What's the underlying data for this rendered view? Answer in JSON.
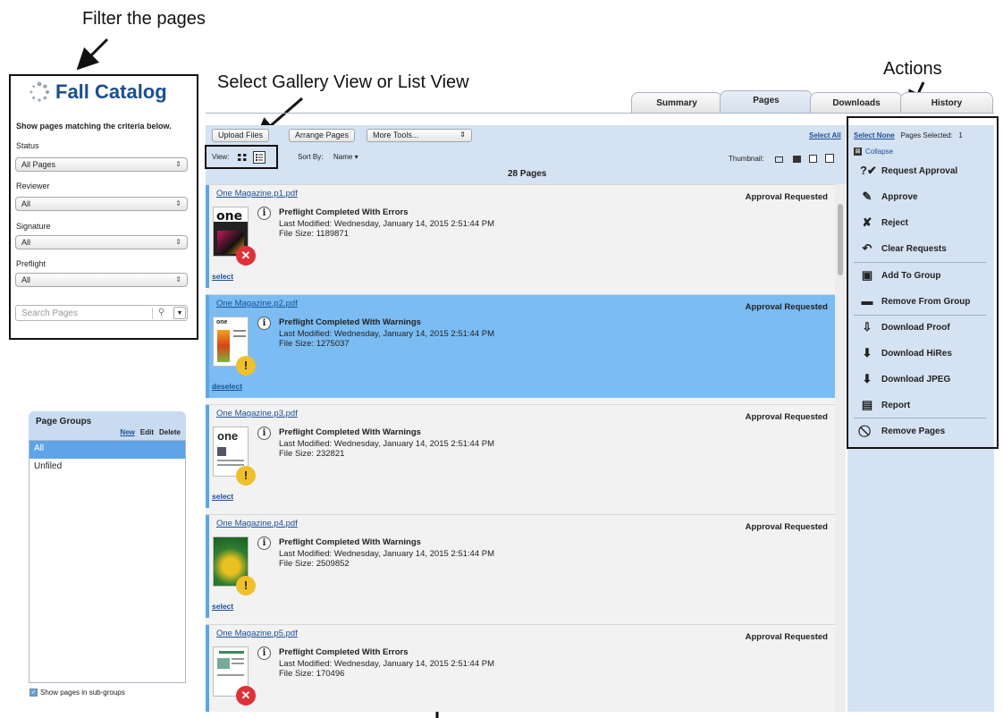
{
  "callouts": {
    "filter": "Filter the pages",
    "view": "Select Gallery View or List View",
    "actions": "Actions"
  },
  "filters": {
    "title": "Fall Catalog",
    "criteria_heading": "Show pages matching the criteria below.",
    "status_label": "Status",
    "status_value": "All Pages",
    "reviewer_label": "Reviewer",
    "reviewer_value": "All",
    "signature_label": "Signature",
    "signature_value": "All",
    "preflight_label": "Preflight",
    "preflight_value": "All",
    "search_placeholder": "Search Pages"
  },
  "page_groups": {
    "title": "Page Groups",
    "new": "New",
    "edit": "Edit",
    "delete": "Delete",
    "items": [
      "All",
      "Unfiled"
    ],
    "subgroups_label": "Show pages in sub-groups"
  },
  "tabs": [
    "Summary",
    "Pages",
    "Downloads",
    "History"
  ],
  "toolbar": {
    "upload": "Upload Files",
    "arrange": "Arrange Pages",
    "more_tools": "More Tools...",
    "select_all": "Select All",
    "select_none": "Select None",
    "pages_selected_label": "Pages Selected:",
    "pages_selected_count": "1",
    "view_label": "View:",
    "sort_label": "Sort By:",
    "sort_value": "Name",
    "thumbnail_label": "Thumbnail:",
    "page_count": "28 Pages",
    "collapse": "Collapse"
  },
  "pages": [
    {
      "file": "One Magazine.p1.pdf",
      "status": "Approval Requested",
      "preflight": "Preflight Completed With Errors",
      "modified": "Last Modified: Wednesday, January 14, 2015 2:51:44 PM",
      "size": "File Size: 1189871",
      "action": "select",
      "badge": "error"
    },
    {
      "file": "One Magazine.p2.pdf",
      "status": "Approval Requested",
      "preflight": "Preflight Completed With Warnings",
      "modified": "Last Modified: Wednesday, January 14, 2015 2:51:44 PM",
      "size": "File Size: 1275037",
      "action": "deselect",
      "badge": "warning"
    },
    {
      "file": "One Magazine.p3.pdf",
      "status": "Approval Requested",
      "preflight": "Preflight Completed With Warnings",
      "modified": "Last Modified: Wednesday, January 14, 2015 2:51:44 PM",
      "size": "File Size: 232821",
      "action": "select",
      "badge": "warning"
    },
    {
      "file": "One Magazine.p4.pdf",
      "status": "Approval Requested",
      "preflight": "Preflight Completed With Warnings",
      "modified": "Last Modified: Wednesday, January 14, 2015 2:51:44 PM",
      "size": "File Size: 2509852",
      "action": "select",
      "badge": "warning"
    },
    {
      "file": "One Magazine.p5.pdf",
      "status": "Approval Requested",
      "preflight": "Preflight Completed With Errors",
      "modified": "Last Modified: Wednesday, January 14, 2015 2:51:44 PM",
      "size": "File Size: 170496",
      "action": "select",
      "badge": "error"
    }
  ],
  "actions": {
    "request_approval": "Request Approval",
    "approve": "Approve",
    "reject": "Reject",
    "clear_requests": "Clear Requests",
    "add_to_group": "Add To Group",
    "remove_from_group": "Remove From Group",
    "download_proof": "Download Proof",
    "download_hires": "Download HiRes",
    "download_jpeg": "Download JPEG",
    "report": "Report",
    "remove_pages": "Remove Pages"
  },
  "colors": {
    "accent": "#1a4f8c",
    "panel": "#d5e2f2",
    "selected_row": "#7bbcf2",
    "error": "#e0303a",
    "warning": "#f0c02a"
  }
}
